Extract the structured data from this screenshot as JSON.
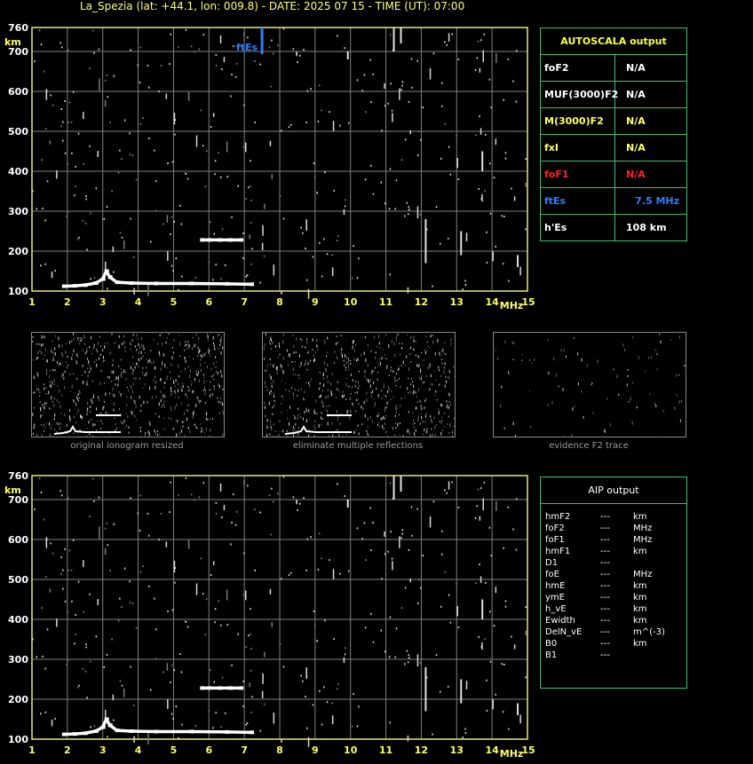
{
  "header": {
    "title": "La_Spezia (lat: +44.1, lon: 009.8) - DATE: 2025 07 15 - TIME (UT): 07:00"
  },
  "colors": {
    "frame": "#e8e870",
    "grid": "#808080",
    "table_border": "#3fbf6f",
    "fEs": "#2a7fff",
    "foF1": "#ff2020",
    "label": "#ffff60"
  },
  "autoscala": {
    "title": "AUTOSCALA output",
    "rows": [
      {
        "label": "foF2",
        "value": "N/A",
        "color": "#ffffff"
      },
      {
        "label": "MUF(3000)F2",
        "value": "N/A",
        "color": "#ffffff"
      },
      {
        "label": "M(3000)F2",
        "value": "N/A",
        "color": "#ffff60"
      },
      {
        "label": "fxI",
        "value": "N/A",
        "color": "#ffff60"
      },
      {
        "label": "foF1",
        "value": "N/A",
        "color": "#ff2020"
      },
      {
        "label": "ftEs",
        "value": "7.5 MHz",
        "color": "#2a7fff"
      },
      {
        "label": "h'Es",
        "value": "108     km",
        "color": "#ffffff"
      }
    ]
  },
  "aip": {
    "title": "AIP output",
    "rows": [
      {
        "name": "hmF2",
        "val": "---",
        "unit": "km"
      },
      {
        "name": "foF2",
        "val": "---",
        "unit": "MHz"
      },
      {
        "name": "foF1",
        "val": "---",
        "unit": "MHz"
      },
      {
        "name": "hmF1",
        "val": "---",
        "unit": "km"
      },
      {
        "name": "D1",
        "val": "---",
        "unit": ""
      },
      {
        "name": "foE",
        "val": "---",
        "unit": "MHz"
      },
      {
        "name": "hmE",
        "val": "---",
        "unit": "km"
      },
      {
        "name": "ymE",
        "val": "---",
        "unit": "km"
      },
      {
        "name": "h_vE",
        "val": "---",
        "unit": "km"
      },
      {
        "name": "Ewidth",
        "val": "---",
        "unit": "km"
      },
      {
        "name": "DelN_vE",
        "val": "---",
        "unit": "m^(-3)"
      },
      {
        "name": "B0",
        "val": "---",
        "unit": "km"
      },
      {
        "name": "B1",
        "val": "---",
        "unit": ""
      }
    ]
  },
  "captions": {
    "thumb1": "original ionogram resized",
    "thumb2": "eliminate multiple reflections",
    "thumb3": "evidence F2 trace"
  },
  "chart_data": [
    {
      "type": "scatter",
      "title": "",
      "xlabel": "MHz",
      "ylabel": "km",
      "xlim": [
        1,
        15
      ],
      "ylim": [
        100,
        760
      ],
      "xticks": [
        "1",
        "2",
        "3",
        "4",
        "5",
        "6",
        "7",
        "8",
        "9",
        "10",
        "11",
        "12",
        "13",
        "14",
        "15"
      ],
      "yticks": [
        "100",
        "200",
        "300",
        "400",
        "500",
        "600",
        "700",
        "760"
      ],
      "annotation": {
        "text": "ftEs",
        "x": 7.5,
        "color": "#2a7fff"
      },
      "series": [
        {
          "values": [
            [
              1.9,
              112
            ],
            [
              2.2,
              113
            ],
            [
              2.5,
              115
            ],
            [
              2.8,
              120
            ],
            [
              3.0,
              130
            ],
            [
              3.1,
              150
            ],
            [
              3.2,
              135
            ],
            [
              3.4,
              122
            ],
            [
              3.8,
              120
            ],
            [
              4.5,
              119
            ],
            [
              5.5,
              119
            ],
            [
              6.5,
              118
            ],
            [
              7.2,
              117
            ]
          ]
        },
        {
          "values": [
            [
              5.8,
              228
            ],
            [
              6.0,
              228
            ],
            [
              6.3,
              228
            ],
            [
              6.6,
              228
            ],
            [
              6.9,
              228
            ]
          ]
        }
      ]
    },
    {
      "type": "scatter",
      "title": "",
      "xlabel": "MHz",
      "ylabel": "km",
      "xlim": [
        1,
        15
      ],
      "ylim": [
        100,
        760
      ],
      "xticks": [
        "1",
        "2",
        "3",
        "4",
        "5",
        "6",
        "7",
        "8",
        "9",
        "10",
        "11",
        "12",
        "13",
        "14",
        "15"
      ],
      "yticks": [
        "100",
        "200",
        "300",
        "400",
        "500",
        "600",
        "700",
        "760"
      ],
      "series": [
        {
          "values": [
            [
              1.9,
              112
            ],
            [
              2.2,
              113
            ],
            [
              2.5,
              115
            ],
            [
              2.8,
              120
            ],
            [
              3.0,
              130
            ],
            [
              3.1,
              150
            ],
            [
              3.2,
              135
            ],
            [
              3.4,
              122
            ],
            [
              3.8,
              120
            ],
            [
              4.5,
              119
            ],
            [
              5.5,
              119
            ],
            [
              6.5,
              118
            ],
            [
              7.2,
              117
            ]
          ]
        },
        {
          "values": [
            [
              5.8,
              228
            ],
            [
              6.0,
              228
            ],
            [
              6.3,
              228
            ],
            [
              6.6,
              228
            ],
            [
              6.9,
              228
            ]
          ]
        }
      ]
    }
  ]
}
